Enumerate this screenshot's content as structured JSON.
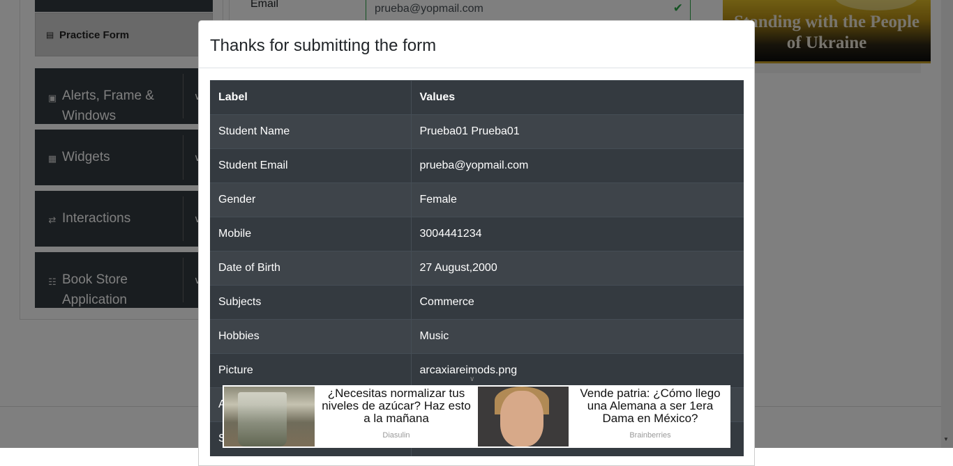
{
  "sidebar": {
    "practice_form": "Practice Form",
    "groups": [
      {
        "label": "Alerts, Frame &",
        "label2": "Windows",
        "icon": "window-icon"
      },
      {
        "label": "Widgets",
        "label2": "",
        "icon": "widgets-icon"
      },
      {
        "label": "Interactions",
        "label2": "",
        "icon": "interactions-icon"
      },
      {
        "label": "Book Store",
        "label2": "Application",
        "icon": "books-icon"
      }
    ]
  },
  "form": {
    "email_label": "Email",
    "email_value": "prueba@yopmail.com"
  },
  "banner": {
    "line1": "Standing with the People",
    "line2": "of Ukraine"
  },
  "modal": {
    "title": "Thanks for submitting the form",
    "table": {
      "headers": [
        "Label",
        "Values"
      ],
      "rows": [
        [
          "Student Name",
          "Prueba01 Prueba01"
        ],
        [
          "Student Email",
          "prueba@yopmail.com"
        ],
        [
          "Gender",
          "Female"
        ],
        [
          "Mobile",
          "3004441234"
        ],
        [
          "Date of Birth",
          "27 August,2000"
        ],
        [
          "Subjects",
          "Commerce"
        ],
        [
          "Hobbies",
          "Music"
        ],
        [
          "Picture",
          "arcaxiareimods.png"
        ],
        [
          "A",
          ""
        ],
        [
          "S",
          ""
        ]
      ]
    }
  },
  "ads": [
    {
      "text": "¿Necesitas normalizar tus niveles de azúcar? Haz esto a la mañana",
      "source": "Diasulin"
    },
    {
      "text": "Vende patria: ¿Cómo llego una Alemana a ser 1era Dama en México?",
      "source": "Brainberries"
    }
  ]
}
